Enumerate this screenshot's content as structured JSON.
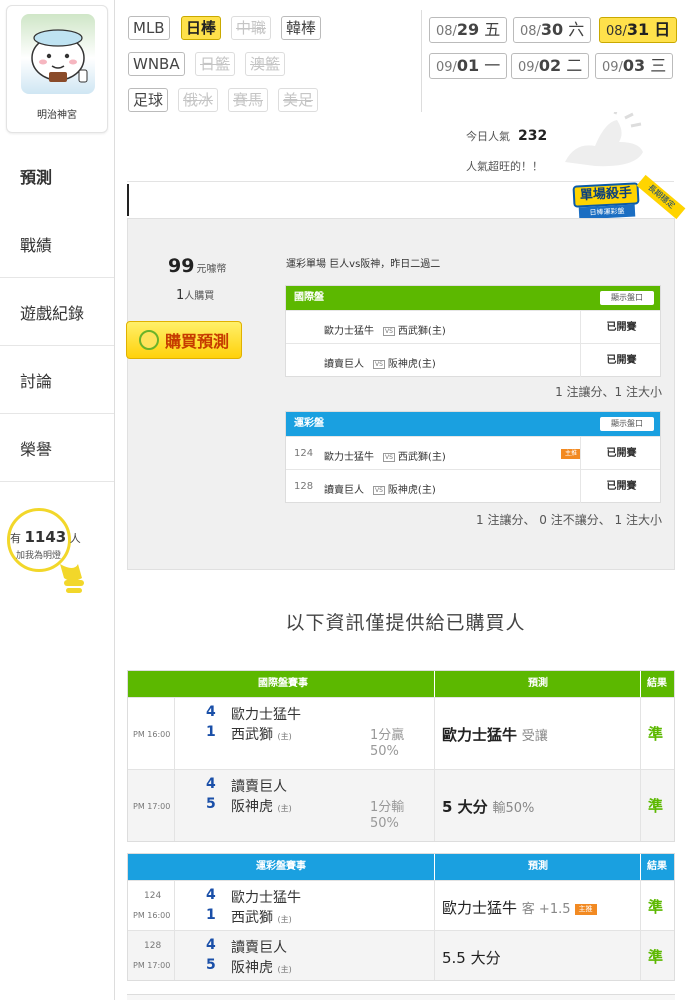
{
  "sidebar": {
    "user_name": "明治神宮",
    "nav": [
      "預測",
      "戰績",
      "遊戲紀錄",
      "討論",
      "榮譽"
    ],
    "fans_prefix": "有",
    "fans_count": "1143",
    "fans_unit": "人",
    "fans_label": "加我為明燈"
  },
  "sports": [
    {
      "label": "MLB",
      "state": "normal"
    },
    {
      "label": "日棒",
      "state": "active"
    },
    {
      "label": "中職",
      "state": "disabled"
    },
    {
      "label": "韓棒",
      "state": "normal"
    },
    {
      "label": "WNBA",
      "state": "normal"
    },
    {
      "label": "日籃",
      "state": "disabled"
    },
    {
      "label": "澳籃",
      "state": "disabled"
    },
    {
      "label": "足球",
      "state": "normal"
    },
    {
      "label": "俄冰",
      "state": "disabled"
    },
    {
      "label": "賽馬",
      "state": "disabled"
    },
    {
      "label": "美足",
      "state": "disabled"
    }
  ],
  "dates": [
    {
      "md": "08/",
      "day": "29",
      "wd": "五",
      "active": false
    },
    {
      "md": "08/",
      "day": "30",
      "wd": "六",
      "active": false
    },
    {
      "md": "08/",
      "day": "31",
      "wd": "日",
      "active": true
    },
    {
      "md": "09/",
      "day": "01",
      "wd": "一",
      "active": false
    },
    {
      "md": "09/",
      "day": "02",
      "wd": "二",
      "active": false
    },
    {
      "md": "09/",
      "day": "03",
      "wd": "三",
      "active": false
    }
  ],
  "popularity": {
    "label": "今日人氣",
    "count": "232",
    "comment": "人氣超旺的！！"
  },
  "badge": {
    "main": "單場殺手",
    "sub": "日棒運彩盤",
    "ribbon": "長期穩定"
  },
  "prediction": {
    "price": "99",
    "price_unit": "元噱幣",
    "buyers": "1",
    "buyers_unit": "人購買",
    "buy_label": "購買預測",
    "coin_icon": "coin-icon",
    "game_title": "運彩單場 巨人vs阪神，昨日二過二",
    "intl": {
      "title": "國際盤",
      "show_label": "顯示盤口",
      "rows": [
        {
          "away": "歐力士猛牛",
          "home": "西武獅(主)",
          "status": "已開賽"
        },
        {
          "away": "讀賣巨人",
          "home": "阪神虎(主)",
          "status": "已開賽"
        }
      ],
      "summary": "1 注讓分、1 注大小"
    },
    "lottery": {
      "title": "運彩盤",
      "show_label": "顯示盤口",
      "rows": [
        {
          "num": "124",
          "away": "歐力士猛牛",
          "home": "西武獅(主)",
          "tag": "主推",
          "status": "已開賽"
        },
        {
          "num": "128",
          "away": "讀賣巨人",
          "home": "阪神虎(主)",
          "tag": "",
          "status": "已開賽"
        }
      ],
      "summary": "1 注讓分、 0 注不讓分、 1 注大小"
    }
  },
  "notice": "以下資訊僅提供給已購買人",
  "intl_table": {
    "headers": [
      "國際盤賽事",
      "預測",
      "結果"
    ],
    "rows": [
      {
        "time": "PM 16:00",
        "s1": "4",
        "t1": "歐力士猛牛",
        "s2": "1",
        "t2": "西武獅",
        "home": "(主)",
        "line1": "1分贏",
        "line2": "50%",
        "pred": "歐力士猛牛",
        "pred_note": "受讓",
        "result": "準"
      },
      {
        "time": "PM 17:00",
        "s1": "4",
        "t1": "讀賣巨人",
        "s2": "5",
        "t2": "阪神虎",
        "home": "(主)",
        "line1": "1分輸",
        "line2": "50%",
        "pred": "5 大分",
        "pred_note": "輸50%",
        "result": "準"
      }
    ]
  },
  "lottery_table": {
    "headers": [
      "運彩盤賽事",
      "預測",
      "結果"
    ],
    "rows": [
      {
        "num": "124",
        "time": "PM 16:00",
        "s1": "4",
        "t1": "歐力士猛牛",
        "s2": "1",
        "t2": "西武獅",
        "home": "(主)",
        "pred": "歐力士猛牛",
        "pred_note": "客 +1.5",
        "tag": "主推",
        "result": "準"
      },
      {
        "num": "128",
        "time": "PM 17:00",
        "s1": "4",
        "t1": "讀賣巨人",
        "s2": "5",
        "t2": "阪神虎",
        "home": "(主)",
        "pred": "5.5 大分",
        "pred_note": "",
        "tag": "",
        "result": "準"
      }
    ]
  },
  "colors": {
    "accent_yellow": "#ffe14b",
    "green": "#5cb800",
    "blue": "#1aa0e0",
    "score_blue": "#1a4fa8",
    "orange_tag": "#f28a22"
  }
}
